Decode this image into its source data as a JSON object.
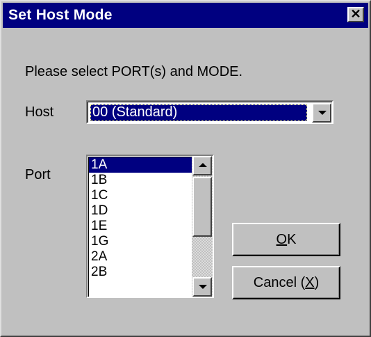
{
  "window": {
    "title": "Set Host Mode",
    "close_glyph": "✕"
  },
  "instruction": "Please select PORT(s) and MODE.",
  "host": {
    "label": "Host",
    "selected_value": "00 (Standard)"
  },
  "port": {
    "label": "Port",
    "items": [
      "1A",
      "1B",
      "1C",
      "1D",
      "1E",
      "1G",
      "2A",
      "2B"
    ],
    "selected": "1A"
  },
  "buttons": {
    "ok": {
      "mnemonic": "O",
      "rest": "K"
    },
    "cancel": {
      "prefix": "Cancel (",
      "mnemonic": "X",
      "suffix": ")"
    }
  },
  "colors": {
    "titlebar": "#000080",
    "face": "#c0c0c0",
    "selection": "#000080"
  }
}
